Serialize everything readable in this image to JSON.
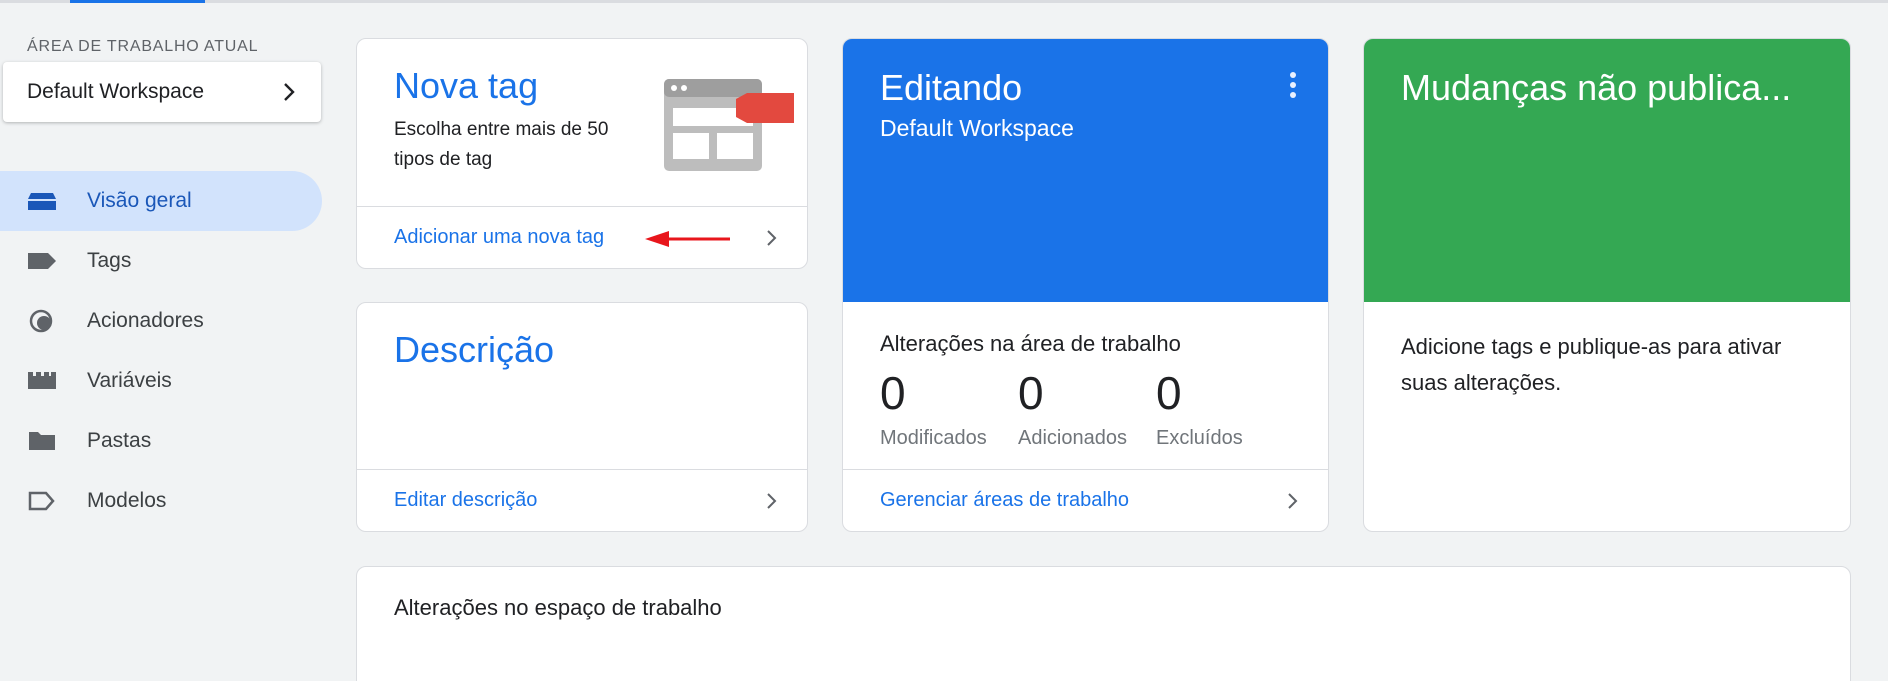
{
  "sidebar": {
    "workspace_label": "ÁREA DE TRABALHO ATUAL",
    "workspace_name": "Default Workspace",
    "items": [
      {
        "label": "Visão geral",
        "icon": "overview-icon",
        "active": true
      },
      {
        "label": "Tags",
        "icon": "tag-icon",
        "active": false
      },
      {
        "label": "Acionadores",
        "icon": "trigger-icon",
        "active": false
      },
      {
        "label": "Variáveis",
        "icon": "variables-icon",
        "active": false
      },
      {
        "label": "Pastas",
        "icon": "folder-icon",
        "active": false
      },
      {
        "label": "Modelos",
        "icon": "template-icon",
        "active": false
      }
    ]
  },
  "new_tag": {
    "title": "Nova tag",
    "subtitle": "Escolha entre mais de 50 tipos de tag",
    "link": "Adicionar uma nova tag"
  },
  "description": {
    "title": "Descrição",
    "link": "Editar descrição"
  },
  "editing": {
    "title": "Editando",
    "workspace": "Default Workspace",
    "stats_title": "Alterações na área de trabalho",
    "stats": [
      {
        "value": "0",
        "label": "Modificados"
      },
      {
        "value": "0",
        "label": "Adicionados"
      },
      {
        "value": "0",
        "label": "Excluídos"
      }
    ],
    "link": "Gerenciar áreas de trabalho"
  },
  "unpublished": {
    "title": "Mudanças não publica...",
    "text": "Adicione tags e publique-as para ativar suas alterações."
  },
  "workspace_changes": {
    "title": "Alterações no espaço de trabalho"
  },
  "colors": {
    "accent": "#1a73e8",
    "green": "#34a853",
    "active_nav": "#d2e3fc",
    "annotation_arrow": "#e8161c"
  }
}
